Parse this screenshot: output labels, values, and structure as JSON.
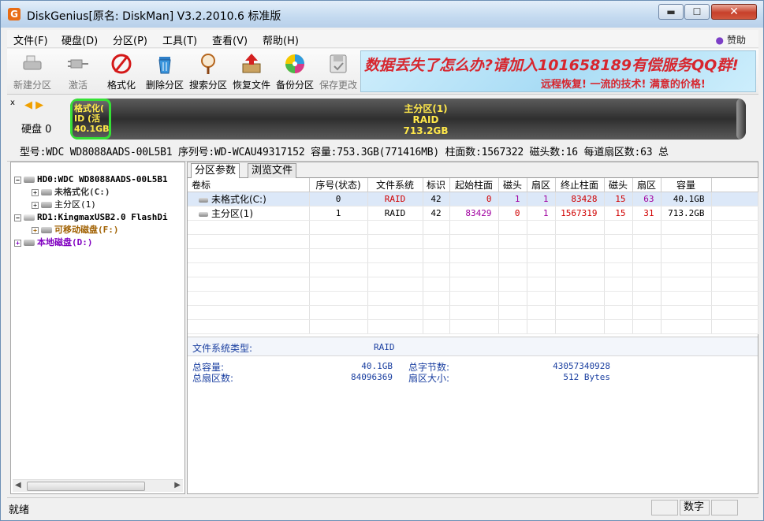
{
  "window": {
    "title": "DiskGenius[原名: DiskMan] V3.2.2010.6 标准版",
    "app_icon": "G",
    "min_glyph": "▬",
    "max_glyph": "☐",
    "close_glyph": "✕"
  },
  "menu": {
    "items": [
      "文件(F)",
      "硬盘(D)",
      "分区(P)",
      "工具(T)",
      "查看(V)",
      "帮助(H)"
    ],
    "sponsor": "赞助"
  },
  "toolbar": {
    "tools": [
      {
        "label": "新建分区",
        "icon": "new-partition-icon",
        "enabled": false
      },
      {
        "label": "激活",
        "icon": "activate-icon",
        "enabled": false
      },
      {
        "label": "格式化",
        "icon": "format-icon",
        "enabled": true
      },
      {
        "label": "删除分区",
        "icon": "delete-partition-icon",
        "enabled": true
      },
      {
        "label": "搜索分区",
        "icon": "search-partition-icon",
        "enabled": true
      },
      {
        "label": "恢复文件",
        "icon": "recover-files-icon",
        "enabled": true
      },
      {
        "label": "备份分区",
        "icon": "backup-partition-icon",
        "enabled": true
      },
      {
        "label": "保存更改",
        "icon": "save-changes-icon",
        "enabled": false
      }
    ],
    "banner_line1": "数据丢失了怎么办?请加入101658189有偿服务QQ群!",
    "banner_line2": "远程恢复!  一流的技术!  满意的价格!"
  },
  "disk_panel": {
    "close_glyph": "x",
    "nav_glyph": "◀ ▶",
    "disk_label": "硬盘 0",
    "part1_text": [
      "格式化(",
      "ID (活",
      "40.1GB"
    ],
    "part2_text": [
      "主分区(1)",
      "RAID",
      "713.2GB"
    ],
    "info": "型号:WDC WD8088AADS-00L5B1   序列号:WD-WCAU49317152   容量:753.3GB(771416MB)   柱面数:1567322   磁头数:16   每道扇区数:63   总"
  },
  "tree": {
    "items": [
      {
        "text": "HD0:WDC WD8088AADS-00L5B1",
        "exp": "−",
        "level": 0,
        "color": "#000000",
        "bold": true
      },
      {
        "text": "未格式化(C:)",
        "exp": "+",
        "level": 1,
        "color": "#333333",
        "bold": true
      },
      {
        "text": "主分区(1)",
        "exp": "+",
        "level": 1,
        "color": "#000000",
        "bold": false
      },
      {
        "text": "RD1:KingmaxUSB2.0 FlashDi",
        "exp": "−",
        "level": 0,
        "color": "#000000",
        "bold": true
      },
      {
        "text": "可移动磁盘(F:)",
        "exp": "+",
        "level": 1,
        "color": "#a06000",
        "bold": true
      },
      {
        "text": "本地磁盘(D:)",
        "exp": "+",
        "level": 0,
        "color": "#8000c0",
        "bold": true
      }
    ],
    "scroll_left": "◀",
    "scroll_right": "▶"
  },
  "tabs": [
    "分区参数",
    "浏览文件"
  ],
  "partition_table": {
    "columns": [
      "卷标",
      "序号(状态)",
      "文件系统",
      "标识",
      "起始柱面",
      "磁头",
      "扇区",
      "终止柱面",
      "磁头",
      "扇区",
      "容量"
    ],
    "rows": [
      {
        "label": "未格式化(C:)",
        "seq": "0",
        "fs": "RAID",
        "id": "42",
        "start_cyl": "0",
        "start_head": "1",
        "start_sec": "1",
        "end_cyl": "83428",
        "end_head": "15",
        "end_sec": "63",
        "size": "40.1GB",
        "selected": true
      },
      {
        "label": "主分区(1)",
        "seq": "1",
        "fs": "RAID",
        "id": "42",
        "start_cyl": "83429",
        "start_head": "0",
        "start_sec": "1",
        "end_cyl": "1567319",
        "end_head": "15",
        "end_sec": "31",
        "size": "713.2GB",
        "selected": false
      }
    ]
  },
  "details": {
    "fs_type_label": "文件系统类型:",
    "fs_type_value": "RAID",
    "total_capacity_label": "总容量:",
    "total_capacity_value": "40.1GB",
    "total_bytes_label": "总字节数:",
    "total_bytes_value": "43057340928",
    "total_sectors_label": "总扇区数:",
    "total_sectors_value": "84096369",
    "sector_size_label": "扇区大小:",
    "sector_size_value": "512 Bytes"
  },
  "statusbar": {
    "status": "就绪",
    "numlock": "数字"
  },
  "colors": {
    "accent_red": "#d00000",
    "accent_purple": "#a000a0",
    "partition_highlight": "#35e035",
    "partition_text": "#ffe84a"
  }
}
